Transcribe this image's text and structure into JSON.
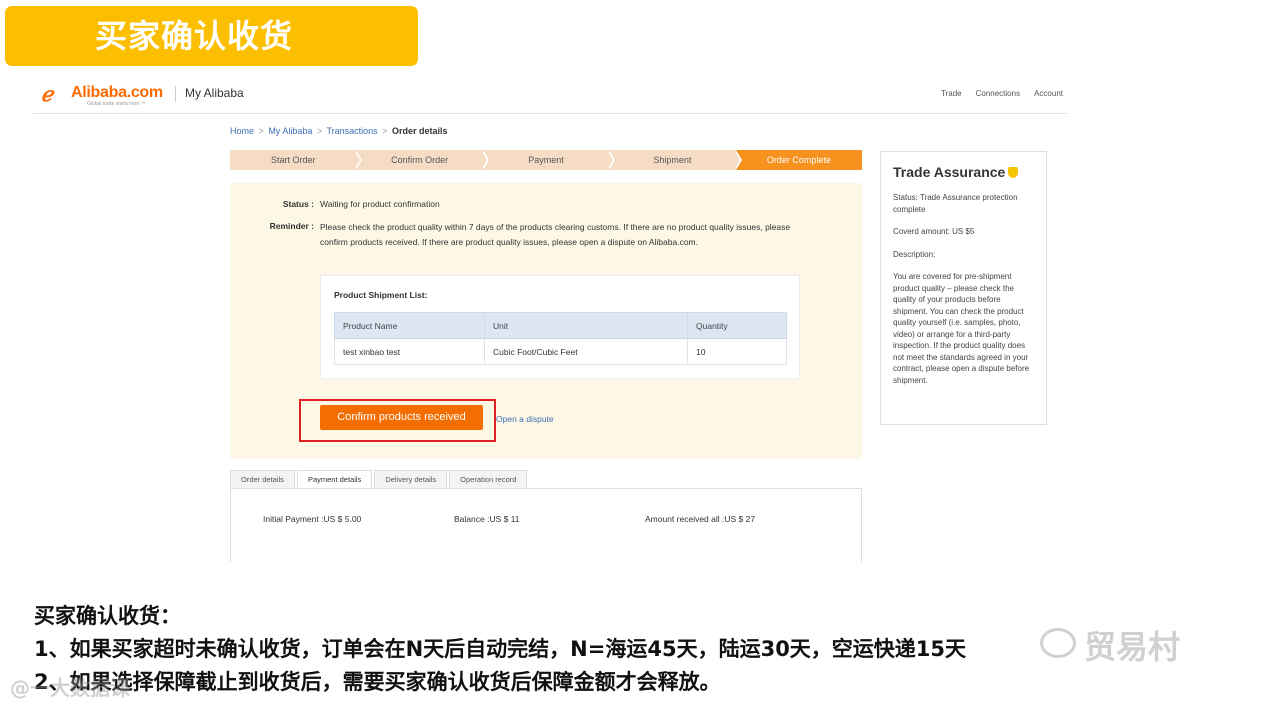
{
  "slide": {
    "title": "买家确认收货",
    "notes": [
      "买家确认收货：",
      "1、如果买家超时未确认收货，订单会在N天后自动完结，N=海运45天，陆运30天，空运快递15天",
      "2、如果选择保障截止到收货后，需要买家确认收货后保障金额才会释放。"
    ],
    "watermark_right": "贸易村",
    "watermark_left": "@一大数据课"
  },
  "header": {
    "logo_text": "Alibaba.com",
    "logo_tagline": "Global trade starts here.™",
    "my_alibaba": "My Alibaba",
    "nav": [
      "Trade",
      "Connections",
      "Account"
    ]
  },
  "breadcrumb": {
    "items": [
      "Home",
      "My Alibaba",
      "Transactions"
    ],
    "separator": ">",
    "current": "Order details"
  },
  "steps": [
    "Start Order",
    "Confirm Order",
    "Payment",
    "Shipment",
    "Order Complete"
  ],
  "status": {
    "status_label": "Status :",
    "status_value": "Waiting for product confirmation",
    "reminder_label": "Reminder :",
    "reminder_text": "Please check the product quality within 7 days of the products clearing customs. If there are no product quality issues, please confirm products received. If there are product quality issues, please open a dispute on Alibaba.com."
  },
  "shipment": {
    "title": "Product Shipment List:",
    "columns": [
      "Product Name",
      "Unit",
      "Quantity"
    ],
    "rows": [
      [
        "test xinbao test",
        "Cubic Foot/Cubic Feet",
        "10"
      ]
    ]
  },
  "actions": {
    "confirm_label": "Confirm products received",
    "dispute_label": "Open a dispute"
  },
  "assurance": {
    "title": "Trade Assurance",
    "status": "Status: Trade Assurance protection complete",
    "covered": "Coverd amount: US $5",
    "description_label": "Description:",
    "description": "You are covered for pre-shipment product quality – please check the quality of your products before shipment. You can check the product quality yourself (i.e. samples, photo, video) or arrange for a third-party inspection. If the product quality does not meet the standards agreed in your contract, please open a dispute before shipment."
  },
  "tabs": {
    "items": [
      "Order details",
      "Payment details",
      "Delivery details",
      "Operation record"
    ],
    "active": 1
  },
  "payment": {
    "initial": "Initial Payment :US $ 5.00",
    "balance": "Balance :US $ 11",
    "received": "Amount received all :US $ 27"
  },
  "colors": {
    "banner": "#fcbf00",
    "accent": "#f36d00",
    "step_active": "#f7921e",
    "highlight": "#e02020",
    "link": "#3e6fb5"
  }
}
